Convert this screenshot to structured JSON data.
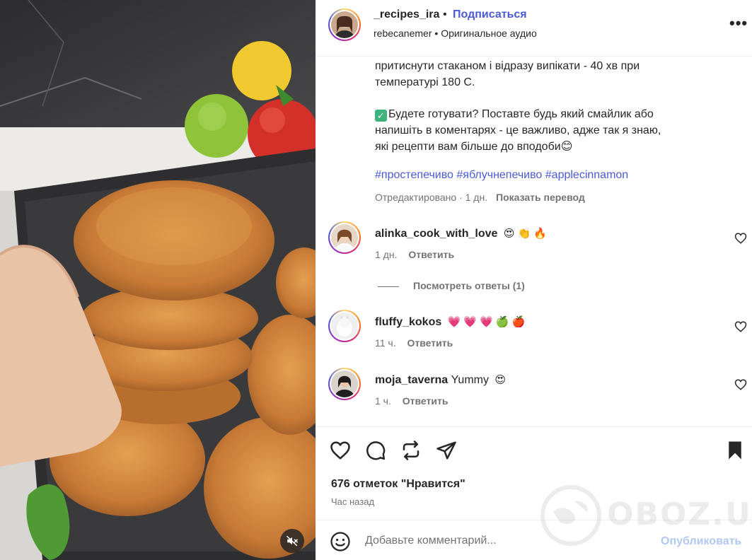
{
  "post": {
    "username": "_recipes_ira",
    "separator": "•",
    "follow_label": "Подписаться",
    "audio_author": "rebecanemer",
    "audio_label": "Оригинальное аудио",
    "more_label": "•••"
  },
  "caption": {
    "line1": "притиснути стаканом і відразу випікати - 40 хв при температурі 180 С.",
    "line2": "Будете готувати? Поставте будь який смайлик або напишіть в коментарях - це важливо, адже так я знаю, які рецепти вам більше до вподоби",
    "line2_emoji": "😊",
    "check_icon": "✓",
    "hashtags": [
      "#простепечиво",
      "#яблучнепечиво",
      "#applecinnamon"
    ],
    "edited": "Отредактировано · 1 дн.",
    "translate": "Показать перевод"
  },
  "comments": [
    {
      "user": "alinka_cook_with_love",
      "text": "",
      "emojis": [
        "😍",
        "👏",
        "🔥"
      ],
      "time": "1 дн.",
      "reply": "Ответить"
    },
    {
      "user": "fluffy_kokos",
      "text": "",
      "emojis": [
        "💗",
        "💗",
        "💗",
        "🍏",
        "🍎"
      ],
      "time": "11 ч.",
      "reply": "Ответить"
    },
    {
      "user": "moja_taverna",
      "text": "Yummy",
      "emojis": [
        "😍"
      ],
      "time": "1 ч.",
      "reply": "Ответить"
    }
  ],
  "view_replies": "Посмотреть ответы (1)",
  "likes": "676 отметок \"Нравится\"",
  "time_ago": "Час назад",
  "add_comment": {
    "placeholder": "Добавьте комментарий...",
    "publish": "Опубликовать"
  },
  "watermark": "OBOZ.UA",
  "colors": {
    "link": "#4a5bd5",
    "publish_disabled": "#b2c7f5",
    "muted": "#737373"
  }
}
